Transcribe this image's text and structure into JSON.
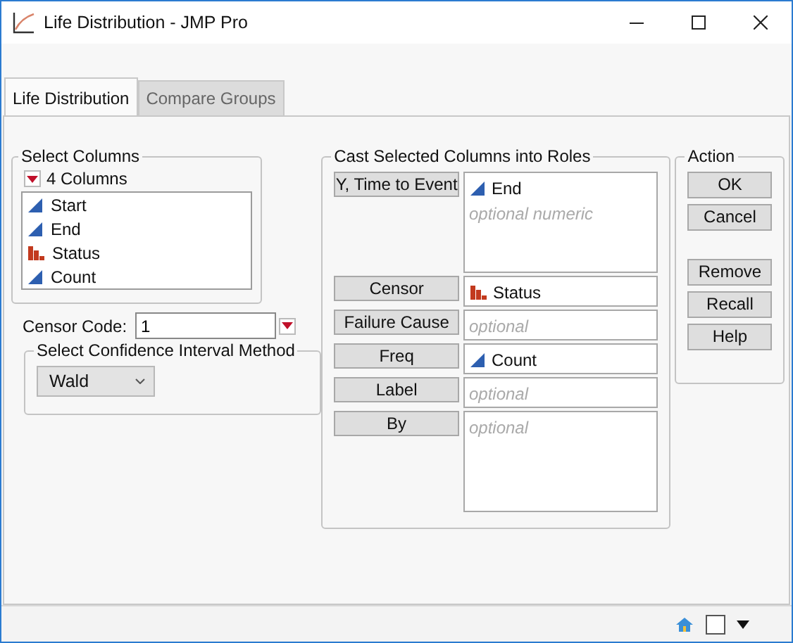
{
  "window": {
    "title": "Life Distribution - JMP Pro"
  },
  "tabs": [
    {
      "label": "Life Distribution",
      "selected": true
    },
    {
      "label": "Compare Groups",
      "selected": false
    }
  ],
  "select_columns": {
    "title": "Select Columns",
    "count_label": "4 Columns",
    "columns": [
      {
        "name": "Start",
        "kind": "continuous"
      },
      {
        "name": "End",
        "kind": "continuous"
      },
      {
        "name": "Status",
        "kind": "nominal"
      },
      {
        "name": "Count",
        "kind": "continuous"
      }
    ]
  },
  "censor_code": {
    "label": "Censor Code:",
    "value": "1"
  },
  "ci_method": {
    "title": "Select Confidence Interval Method",
    "value": "Wald"
  },
  "roles": {
    "title": "Cast Selected Columns into Roles",
    "items": [
      {
        "button": "Y, Time to Event",
        "kind": "multi",
        "assigned": [
          {
            "name": "End",
            "kind": "continuous"
          }
        ],
        "placeholder": "optional numeric"
      },
      {
        "button": "Censor",
        "kind": "single",
        "assigned": [
          {
            "name": "Status",
            "kind": "nominal"
          }
        ]
      },
      {
        "button": "Failure Cause",
        "kind": "single",
        "placeholder": "optional"
      },
      {
        "button": "Freq",
        "kind": "single",
        "assigned": [
          {
            "name": "Count",
            "kind": "continuous"
          }
        ]
      },
      {
        "button": "Label",
        "kind": "single",
        "placeholder": "optional"
      },
      {
        "button": "By",
        "kind": "multi",
        "placeholder": "optional"
      }
    ]
  },
  "actions": {
    "title": "Action",
    "groups": [
      [
        "OK",
        "Cancel"
      ],
      [
        "Remove",
        "Recall",
        "Help"
      ]
    ]
  }
}
